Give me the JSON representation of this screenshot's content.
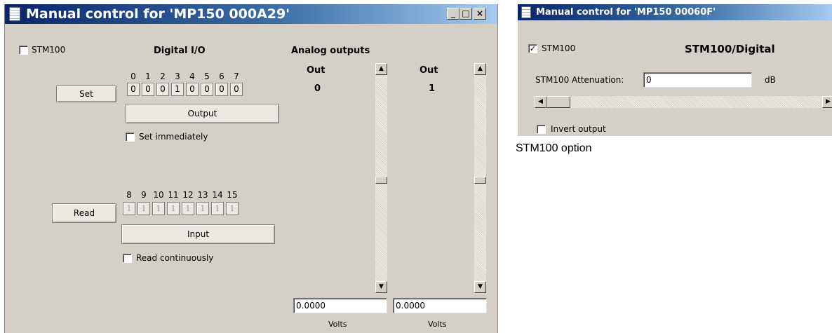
{
  "window1": {
    "title": "Manual control for 'MP150 000A29'",
    "min_label": "_",
    "max_label": "□",
    "close_label": "×",
    "stm100_label": "STM100",
    "stm100_checked": false,
    "digital_heading": "Digital I/O",
    "analog_heading": "Analog outputs",
    "set_button": "Set",
    "output_button": "Output",
    "set_immediately_label": "Set immediately",
    "read_button": "Read",
    "input_button": "Input",
    "read_continuously_label": "Read continuously",
    "out_bits": {
      "numbers": [
        "0",
        "1",
        "2",
        "3",
        "4",
        "5",
        "6",
        "7"
      ],
      "values": [
        "0",
        "0",
        "0",
        "1",
        "0",
        "0",
        "0",
        "0"
      ]
    },
    "in_bits": {
      "numbers": [
        "8",
        "9",
        "10",
        "11",
        "12",
        "13",
        "14",
        "15"
      ],
      "values": [
        "1",
        "1",
        "1",
        "1",
        "1",
        "1",
        "1",
        "1"
      ]
    },
    "channels": [
      {
        "label": "Out",
        "number": "0",
        "value": "0.0000",
        "units": "Volts"
      },
      {
        "label": "Out",
        "number": "1",
        "value": "0.0000",
        "units": "Volts"
      }
    ]
  },
  "window2": {
    "title": "Manual control for 'MP150 00060F'",
    "stm100_label": "STM100",
    "stm100_checked": true,
    "heading": "STM100/Digital",
    "attenuation_label": "STM100 Attenuation:",
    "attenuation_value": "0",
    "attenuation_units": "dB",
    "invert_label": "Invert output"
  },
  "caption": "STM100 option",
  "icons": {
    "check_glyph": "✓",
    "up_arrow": "▲",
    "down_arrow": "▼",
    "left_arrow": "◀",
    "right_arrow": "▶"
  }
}
